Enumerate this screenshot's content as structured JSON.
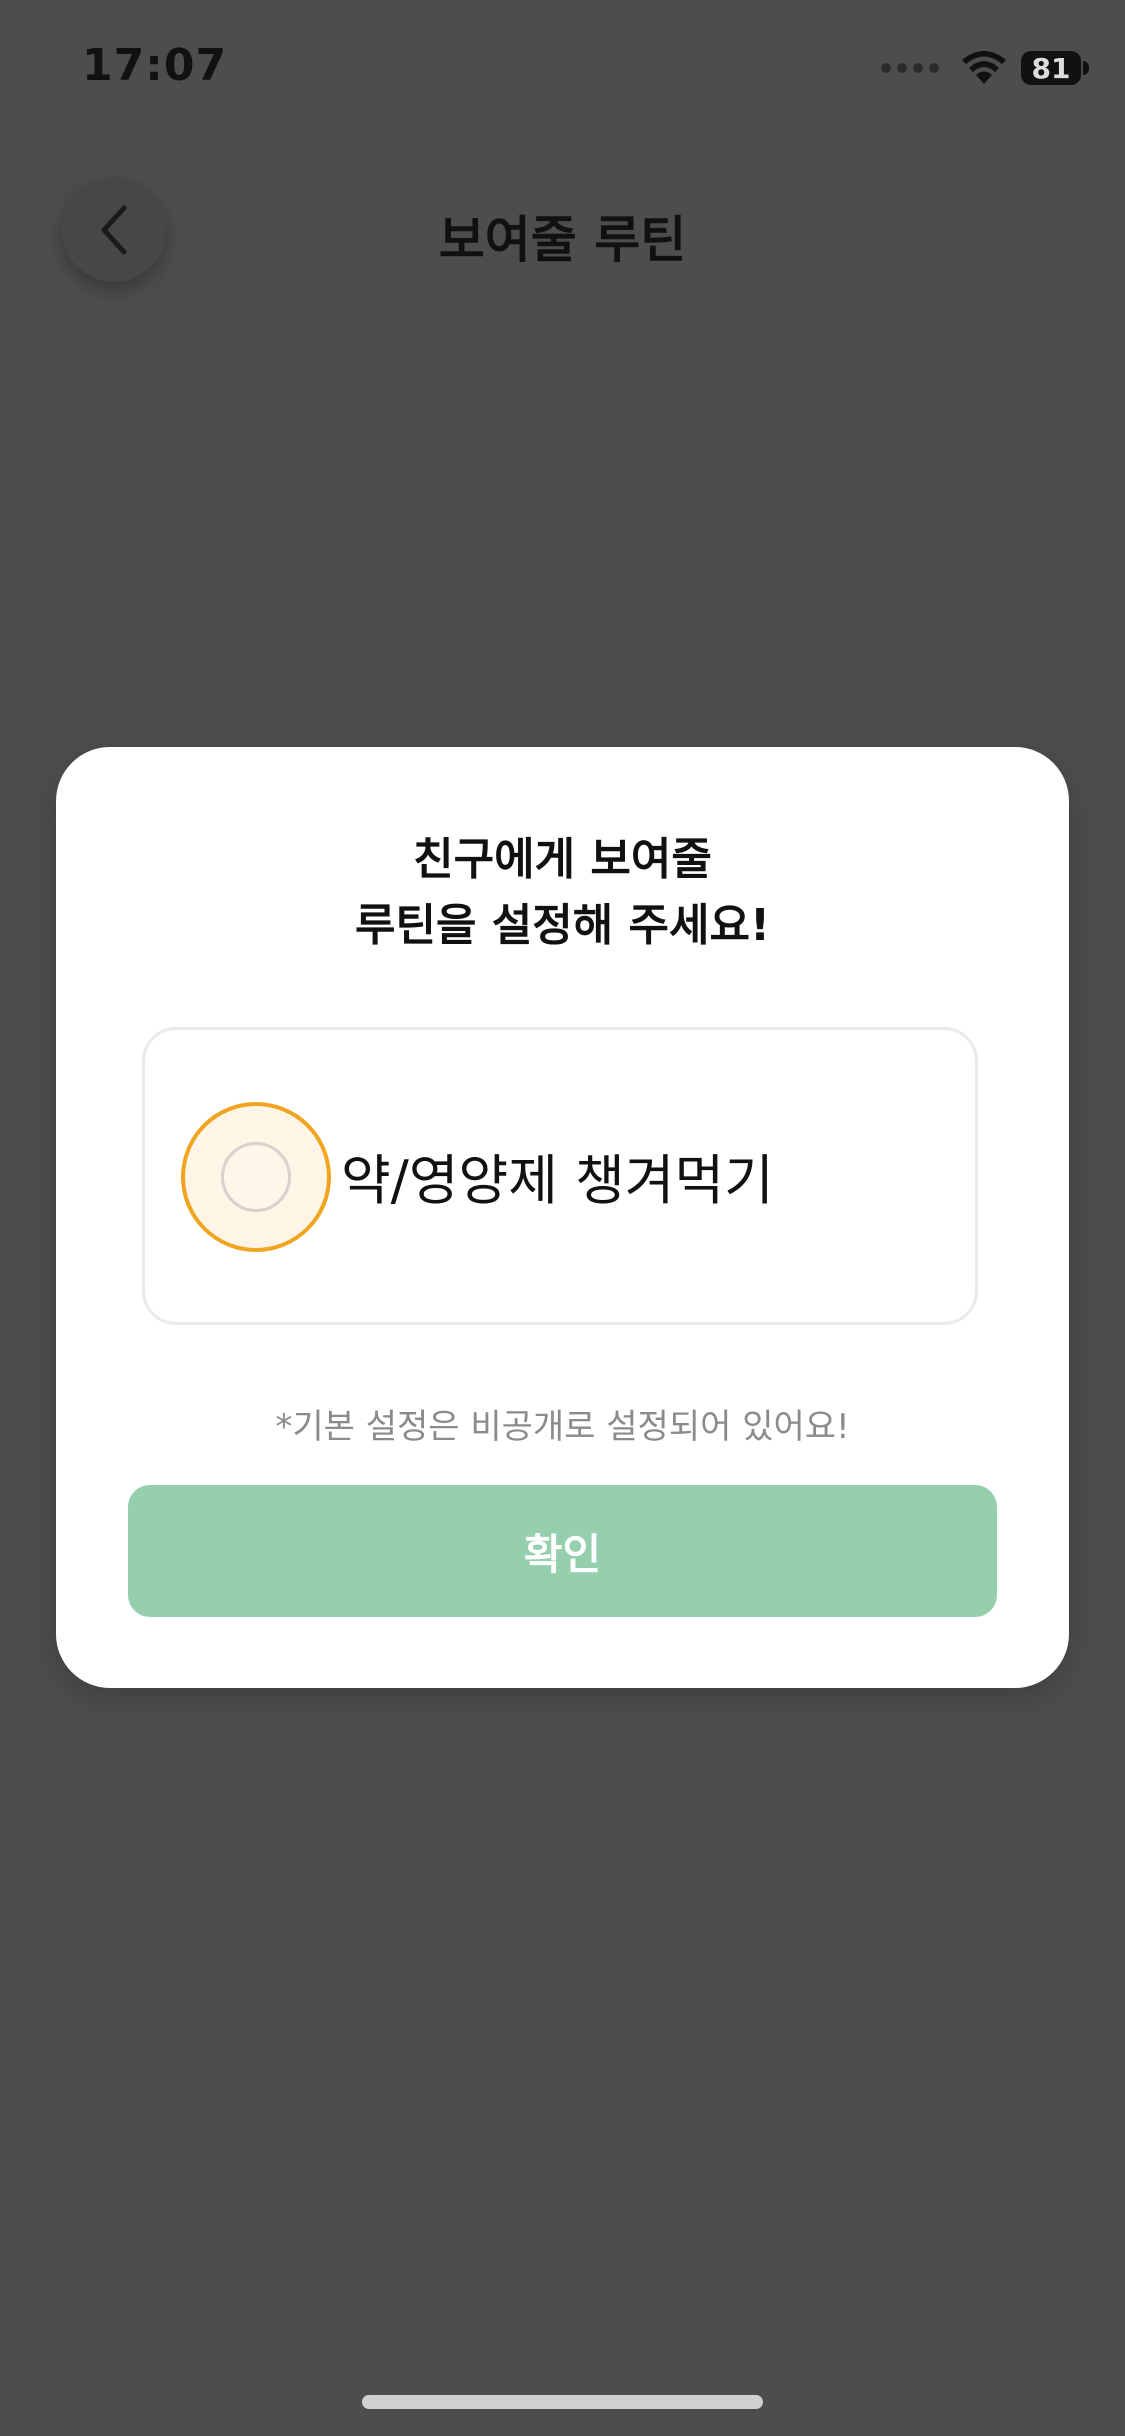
{
  "status_bar": {
    "time": "17:07",
    "battery_level": "81",
    "icons": [
      "signal-dots-icon",
      "wifi-icon",
      "battery-icon"
    ]
  },
  "header": {
    "title": "보여줄 루틴",
    "back_icon": "chevron-left-icon"
  },
  "modal": {
    "title_line_1": "친구에게 보여줄",
    "title_line_2": "루틴을 설정해 주세요!",
    "routine": {
      "label": "약/영양제 챙겨먹기",
      "selected": false,
      "colors": {
        "ring": "#f0a420",
        "fill": "#fff5e6"
      }
    },
    "note": "*기본 설정은 비공개로 설정되어 있어요!",
    "confirm_label": "확인"
  },
  "colors": {
    "backdrop": "#4d4d4d",
    "confirm_disabled": "#95cfad"
  }
}
